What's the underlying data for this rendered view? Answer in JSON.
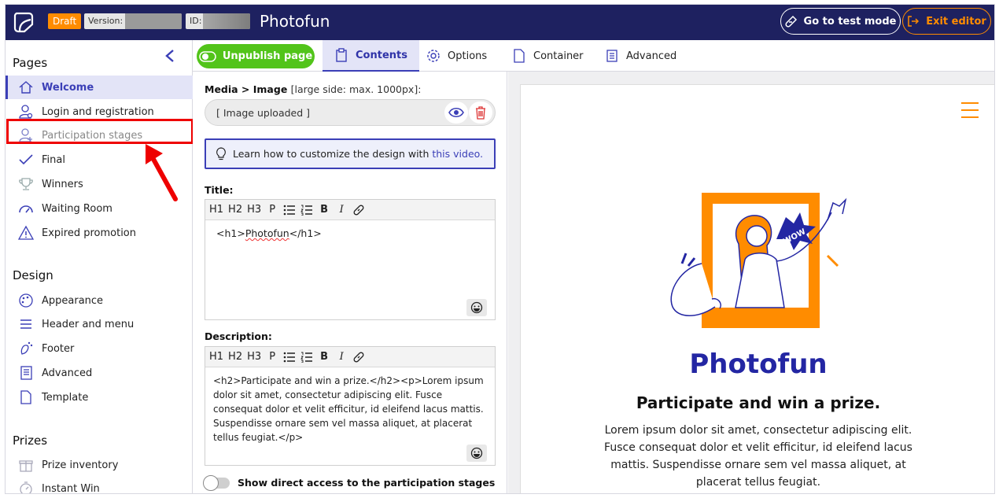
{
  "topbar": {
    "draft_label": "Draft",
    "version_label": "Version:",
    "id_label": "ID:",
    "app_title": "Photofun",
    "test_mode_label": "Go to test mode",
    "exit_label": "Exit editor"
  },
  "sidebar": {
    "pages_title": "Pages",
    "pages": [
      {
        "label": "Welcome"
      },
      {
        "label": "Login and registration"
      },
      {
        "label": "Participation stages"
      },
      {
        "label": "Final"
      },
      {
        "label": "Winners"
      },
      {
        "label": "Waiting Room"
      },
      {
        "label": "Expired promotion"
      }
    ],
    "design_title": "Design",
    "design": [
      {
        "label": "Appearance"
      },
      {
        "label": "Header and menu"
      },
      {
        "label": "Footer"
      },
      {
        "label": "Advanced"
      },
      {
        "label": "Template"
      }
    ],
    "prizes_title": "Prizes",
    "prizes": [
      {
        "label": "Prize inventory"
      },
      {
        "label": "Instant Win"
      }
    ]
  },
  "toolbar": {
    "unpublish_label": "Unpublish page",
    "tabs": [
      {
        "label": "Contents"
      },
      {
        "label": "Options"
      },
      {
        "label": "Container"
      },
      {
        "label": "Advanced"
      }
    ]
  },
  "form": {
    "media_label": "Media > Image",
    "media_note": "[large side: max. 1000px]:",
    "image_value": "[ Image uploaded ]",
    "info_text": "Learn how to customize the design with ",
    "info_link": "this video.",
    "title_label": "Title:",
    "toolbar_buttons": [
      "H1",
      "H2",
      "H3",
      "P",
      "B",
      "I"
    ],
    "title_value_pre": "<h1>",
    "title_value_word": "Photofun",
    "title_value_post": "</h1>",
    "description_label": "Description:",
    "description_value": "<h2>Participate and win a prize.</h2><p>Lorem ipsum dolor sit amet, consectetur adipiscing elit. Fusce consequat dolor et velit efficitur, id eleifend lacus mattis. Suspendisse ornare sem vel massa aliquet, at placerat tellus feugiat.</p>",
    "toggle_label": "Show direct access to the participation stages"
  },
  "preview": {
    "badge_text": "WOW",
    "title": "Photofun",
    "subtitle": "Participate and win a prize.",
    "description": "Lorem ipsum dolor sit amet, consectetur adipiscing elit. Fusce consequat dolor et velit efficitur, id eleifend lacus mattis. Suspendisse ornare sem vel massa aliquet, at placerat tellus feugiat."
  },
  "colors": {
    "topbar": "#1e2160",
    "accent": "#3b3fb7",
    "orange": "#ff8c00",
    "green": "#52c41a",
    "highlight": "#e00000"
  }
}
